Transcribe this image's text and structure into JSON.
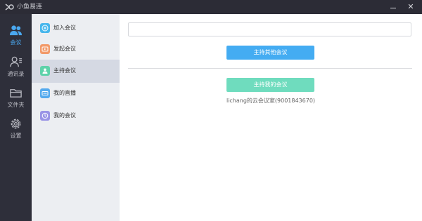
{
  "window": {
    "title": "小鱼易连"
  },
  "nav": [
    {
      "label": "会议",
      "icon": "users-icon",
      "active": true
    },
    {
      "label": "通讯录",
      "icon": "contacts-icon",
      "active": false
    },
    {
      "label": "文件夹",
      "icon": "folder-icon",
      "active": false
    },
    {
      "label": "设置",
      "icon": "gear-icon",
      "active": false
    }
  ],
  "submenu": [
    {
      "label": "加入会议",
      "icon": "plus-circle-icon",
      "color": "#47b6ec"
    },
    {
      "label": "发起会议",
      "icon": "start-meeting-icon",
      "color": "#f29a6a"
    },
    {
      "label": "主持会议",
      "icon": "host-meeting-icon",
      "color": "#5fd2aa",
      "active": true
    },
    {
      "label": "我的直播",
      "icon": "live-icon",
      "color": "#55aaee"
    },
    {
      "label": "我的会议",
      "icon": "clock-icon",
      "color": "#9a94e6"
    }
  ],
  "main": {
    "input_value": "",
    "host_other_label": "主持其他会议",
    "host_mine_label": "主持我的会议",
    "room_info": "lichang的云会议室(9001843670)"
  },
  "colors": {
    "accent_blue": "#44acf2",
    "accent_green": "#6fdcbe",
    "nav_bg": "#2e2f3a",
    "title_bg": "#2c2c36"
  }
}
